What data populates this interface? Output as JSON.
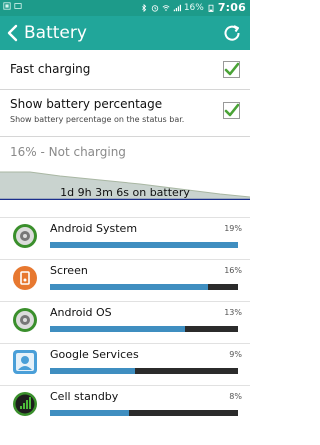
{
  "status_bar": {
    "time": "7:06",
    "battery_percent_label": "16%",
    "icons": [
      "screenshot-icon",
      "notification-icon",
      "bluetooth-icon",
      "alarm-icon",
      "wifi-icon",
      "signal-icon",
      "battery-icon"
    ]
  },
  "action_bar": {
    "title": "Battery",
    "back_icon": "back-chevron-icon",
    "refresh_icon": "refresh-icon"
  },
  "settings": {
    "fast_charging": {
      "label": "Fast charging",
      "checked": true
    },
    "show_percentage": {
      "label": "Show battery percentage",
      "sublabel": "Show battery percentage on the status bar.",
      "checked": true
    }
  },
  "status": {
    "text": "16% - Not charging"
  },
  "graph": {
    "label": "1d 9h 3m 6s on battery"
  },
  "apps": [
    {
      "name": "Android System",
      "percent_label": "19%",
      "fraction": 1.0,
      "icon": "android-system-icon"
    },
    {
      "name": "Screen",
      "percent_label": "16%",
      "fraction": 0.84,
      "icon": "screen-icon"
    },
    {
      "name": "Android OS",
      "percent_label": "13%",
      "fraction": 0.72,
      "icon": "android-os-icon"
    },
    {
      "name": "Google Services",
      "percent_label": "9%",
      "fraction": 0.45,
      "icon": "google-services-icon"
    },
    {
      "name": "Cell standby",
      "percent_label": "8%",
      "fraction": 0.42,
      "icon": "cell-standby-icon"
    }
  ],
  "colors": {
    "accent": "#21a69a",
    "check": "#4aa337",
    "bar": "#3f8ec0"
  }
}
